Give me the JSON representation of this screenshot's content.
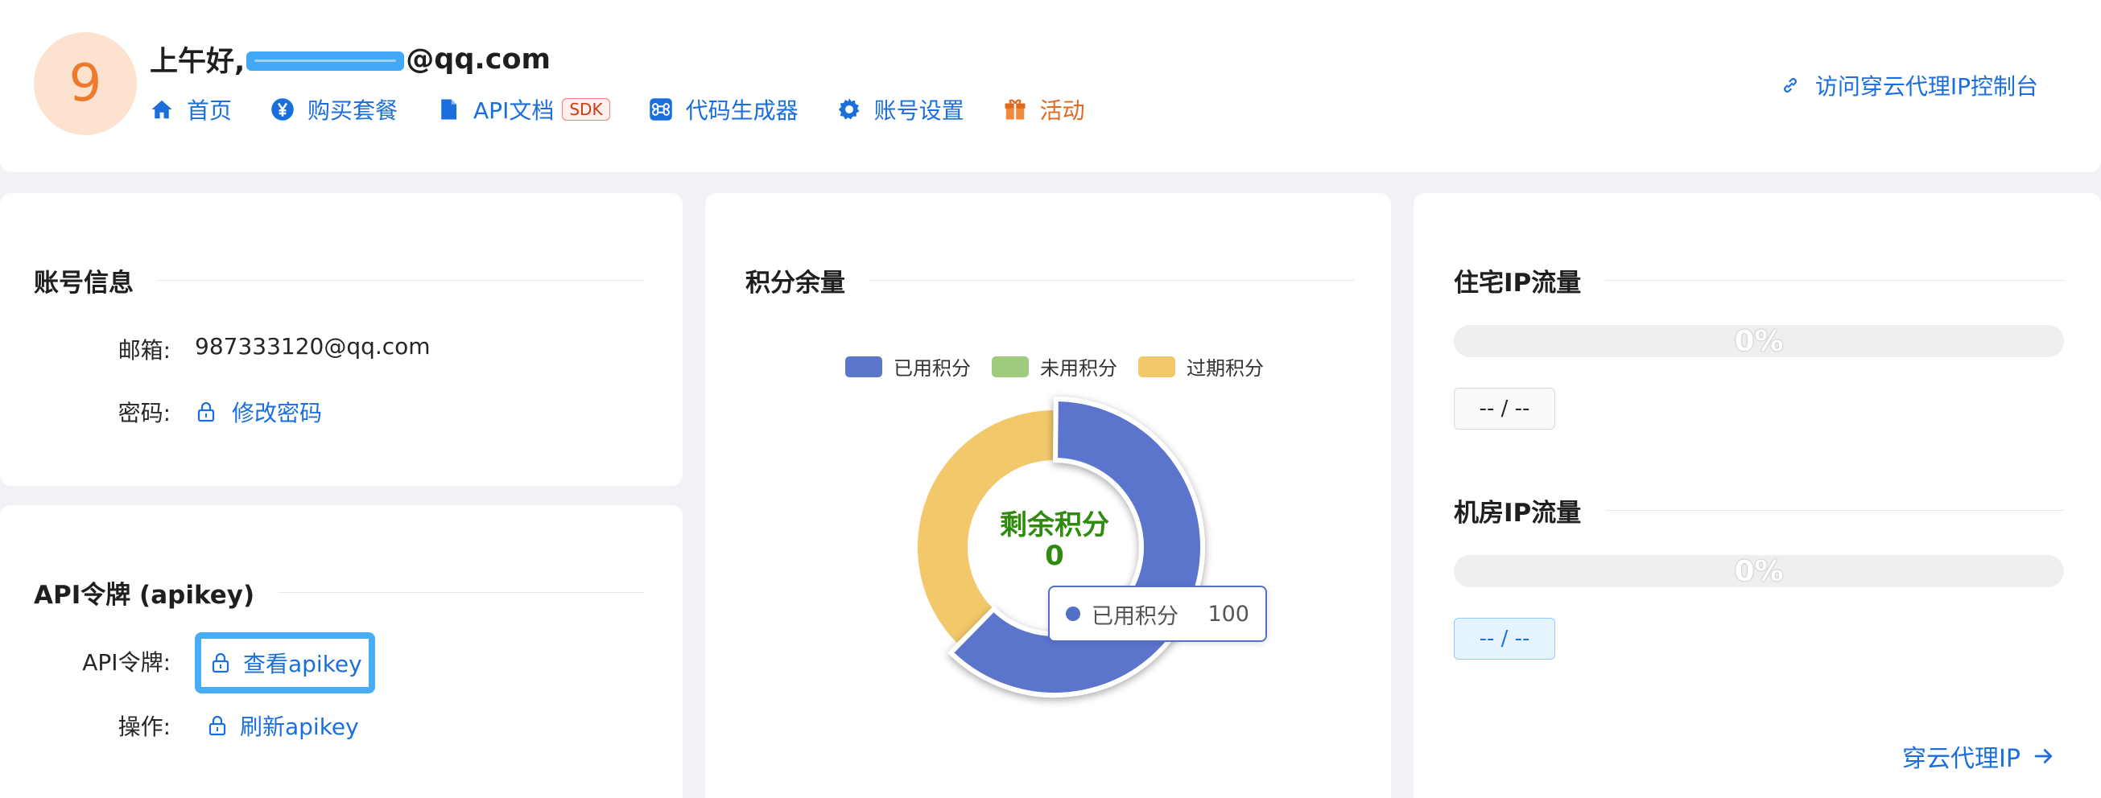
{
  "header": {
    "avatar_letter": "9",
    "greeting_prefix": "上午好,",
    "greeting_suffix": "@qq.com",
    "nav": [
      {
        "label": "首页",
        "icon": "home-icon"
      },
      {
        "label": "购买套餐",
        "icon": "yen-icon"
      },
      {
        "label": "API文档",
        "icon": "doc-icon",
        "badge": "SDK"
      },
      {
        "label": "代码生成器",
        "icon": "command-icon"
      },
      {
        "label": "账号设置",
        "icon": "gear-icon"
      },
      {
        "label": "活动",
        "icon": "gift-icon"
      }
    ],
    "console_link": "访问穿云代理IP控制台"
  },
  "account": {
    "title": "账号信息",
    "email_label": "邮箱:",
    "email_value": "987333120@qq.com",
    "password_label": "密码:",
    "password_action": "修改密码"
  },
  "apikey": {
    "title": "API令牌 (apikey)",
    "token_label": "API令牌:",
    "token_action": "查看apikey",
    "op_label": "操作:",
    "op_action": "刷新apikey"
  },
  "credits": {
    "title": "积分余量",
    "center_label": "剩余积分",
    "center_value": "0",
    "tooltip_label": "已用积分",
    "tooltip_value": "100"
  },
  "chart_data": {
    "type": "pie",
    "categories": [
      "已用积分",
      "未用积分",
      "过期积分"
    ],
    "values": [
      100,
      0,
      60
    ],
    "colors": [
      "#5b74cc",
      "#9ecb7c",
      "#f2c86a"
    ],
    "highlighted": "已用积分",
    "legend": "top"
  },
  "traffic": {
    "residential_title": "住宅IP流量",
    "residential_percent": "0%",
    "residential_fraction": 0,
    "residential_usage": "-- / --",
    "datacenter_title": "机房IP流量",
    "datacenter_percent": "0%",
    "datacenter_fraction": 0,
    "datacenter_usage": "-- / --",
    "more_link": "穿云代理IP"
  },
  "colors": {
    "primary": "#1a6fdc",
    "accent_orange": "#e06a1f",
    "success_green": "#2e8b0e",
    "highlight_border": "#47aef5"
  }
}
